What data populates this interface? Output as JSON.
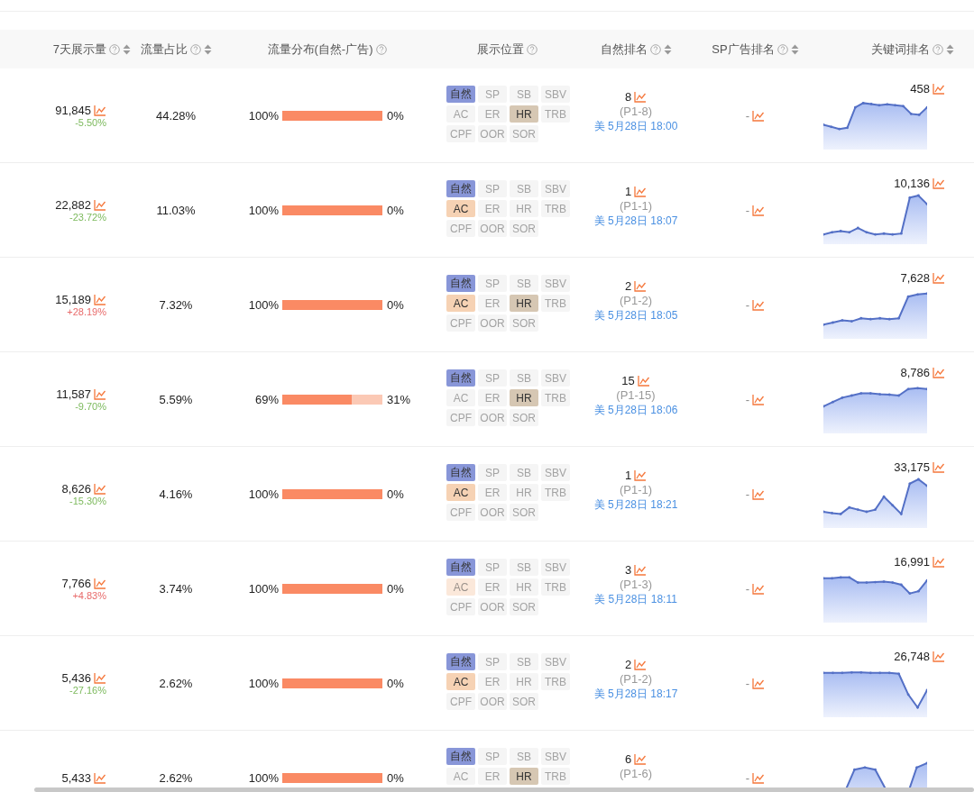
{
  "columns": [
    {
      "label": "7天展示量",
      "sortable": true
    },
    {
      "label": "流量占比",
      "sortable": true
    },
    {
      "label": "流量分布(自然-广告)",
      "sortable": false
    },
    {
      "label": "展示位置",
      "sortable": false
    },
    {
      "label": "自然排名",
      "sortable": true
    },
    {
      "label": "SP广告排名",
      "sortable": true
    },
    {
      "label": "关键词排名",
      "sortable": true
    }
  ],
  "rows": [
    {
      "impressions": "91,845",
      "change": "-5.50%",
      "rising": false,
      "share": "44.28%",
      "flow": {
        "natural": "100%",
        "ad": "0%",
        "level": 1
      },
      "tags": [
        {
          "label": "自然",
          "active": true,
          "color": "#8896d8"
        },
        {
          "label": "SP",
          "active": false
        },
        {
          "label": "SB",
          "active": false
        },
        {
          "label": "SBV",
          "active": false
        },
        {
          "label": "AC",
          "active": false
        },
        {
          "label": "ER",
          "active": false
        },
        {
          "label": "HR",
          "active": true,
          "color": "#d6c7b3"
        },
        {
          "label": "TRB",
          "active": false
        },
        {
          "label": "CPF",
          "active": false
        },
        {
          "label": "OOR",
          "active": false
        },
        {
          "label": "SOR",
          "active": false
        }
      ],
      "rank": "8",
      "rank_page": "(P1-8)",
      "rank_time": "美 5月28日 18:00",
      "sp_rank": "-",
      "keyword_rank": "458"
    },
    {
      "impressions": "22,882",
      "change": "-23.72%",
      "rising": false,
      "share": "11.03%",
      "flow": {
        "natural": "100%",
        "ad": "0%",
        "level": 1
      },
      "tags": [
        {
          "label": "自然",
          "active": true,
          "color": "#8896d8"
        },
        {
          "label": "SP",
          "active": false
        },
        {
          "label": "SB",
          "active": false
        },
        {
          "label": "SBV",
          "active": false
        },
        {
          "label": "AC",
          "active": true,
          "color": "#f6d2b4"
        },
        {
          "label": "ER",
          "active": false
        },
        {
          "label": "HR",
          "active": false
        },
        {
          "label": "TRB",
          "active": false
        },
        {
          "label": "CPF",
          "active": false
        },
        {
          "label": "OOR",
          "active": false
        },
        {
          "label": "SOR",
          "active": false
        }
      ],
      "rank": "1",
      "rank_page": "(P1-1)",
      "rank_time": "美 5月28日 18:07",
      "sp_rank": "-",
      "keyword_rank": "10,136"
    },
    {
      "impressions": "15,189",
      "change": "+28.19%",
      "rising": true,
      "share": "7.32%",
      "flow": {
        "natural": "100%",
        "ad": "0%",
        "level": 1
      },
      "tags": [
        {
          "label": "自然",
          "active": true,
          "color": "#8896d8"
        },
        {
          "label": "SP",
          "active": false
        },
        {
          "label": "SB",
          "active": false
        },
        {
          "label": "SBV",
          "active": false
        },
        {
          "label": "AC",
          "active": true,
          "color": "#f6d2b4"
        },
        {
          "label": "ER",
          "active": false
        },
        {
          "label": "HR",
          "active": true,
          "color": "#d6c7b3"
        },
        {
          "label": "TRB",
          "active": false
        },
        {
          "label": "CPF",
          "active": false
        },
        {
          "label": "OOR",
          "active": false
        },
        {
          "label": "SOR",
          "active": false
        }
      ],
      "rank": "2",
      "rank_page": "(P1-2)",
      "rank_time": "美 5月28日 18:05",
      "sp_rank": "-",
      "keyword_rank": "7,628"
    },
    {
      "impressions": "11,587",
      "change": "-9.70%",
      "rising": false,
      "share": "5.59%",
      "flow": {
        "natural": "69%",
        "ad": "31%",
        "level": 0.69
      },
      "tags": [
        {
          "label": "自然",
          "active": true,
          "color": "#8896d8"
        },
        {
          "label": "SP",
          "active": false
        },
        {
          "label": "SB",
          "active": false
        },
        {
          "label": "SBV",
          "active": false
        },
        {
          "label": "AC",
          "active": false
        },
        {
          "label": "ER",
          "active": false
        },
        {
          "label": "HR",
          "active": true,
          "color": "#d6c7b3"
        },
        {
          "label": "TRB",
          "active": false
        },
        {
          "label": "CPF",
          "active": false
        },
        {
          "label": "OOR",
          "active": false
        },
        {
          "label": "SOR",
          "active": false
        }
      ],
      "rank": "15",
      "rank_page": "(P1-15)",
      "rank_time": "美 5月28日 18:06",
      "sp_rank": "-",
      "keyword_rank": "8,786"
    },
    {
      "impressions": "8,626",
      "change": "-15.30%",
      "rising": false,
      "share": "4.16%",
      "flow": {
        "natural": "100%",
        "ad": "0%",
        "level": 1
      },
      "tags": [
        {
          "label": "自然",
          "active": true,
          "color": "#8896d8"
        },
        {
          "label": "SP",
          "active": false
        },
        {
          "label": "SB",
          "active": false
        },
        {
          "label": "SBV",
          "active": false
        },
        {
          "label": "AC",
          "active": true,
          "color": "#f6d2b4"
        },
        {
          "label": "ER",
          "active": false
        },
        {
          "label": "HR",
          "active": false
        },
        {
          "label": "TRB",
          "active": false
        },
        {
          "label": "CPF",
          "active": false
        },
        {
          "label": "OOR",
          "active": false
        },
        {
          "label": "SOR",
          "active": false
        }
      ],
      "rank": "1",
      "rank_page": "(P1-1)",
      "rank_time": "美 5月28日 18:21",
      "sp_rank": "-",
      "keyword_rank": "33,175"
    },
    {
      "impressions": "7,766",
      "change": "+4.83%",
      "rising": true,
      "share": "3.74%",
      "flow": {
        "natural": "100%",
        "ad": "0%",
        "level": 1
      },
      "tags": [
        {
          "label": "自然",
          "active": true,
          "color": "#8896d8"
        },
        {
          "label": "SP",
          "active": false
        },
        {
          "label": "SB",
          "active": false
        },
        {
          "label": "SBV",
          "active": false
        },
        {
          "label": "AC",
          "active": true,
          "color": "#fbe8da"
        },
        {
          "label": "ER",
          "active": false
        },
        {
          "label": "HR",
          "active": false
        },
        {
          "label": "TRB",
          "active": false
        },
        {
          "label": "CPF",
          "active": false
        },
        {
          "label": "OOR",
          "active": false
        },
        {
          "label": "SOR",
          "active": false
        }
      ],
      "rank": "3",
      "rank_page": "(P1-3)",
      "rank_time": "美 5月28日 18:11",
      "sp_rank": "-",
      "keyword_rank": "16,991"
    },
    {
      "impressions": "5,436",
      "change": "-27.16%",
      "rising": false,
      "share": "2.62%",
      "flow": {
        "natural": "100%",
        "ad": "0%",
        "level": 1
      },
      "tags": [
        {
          "label": "自然",
          "active": true,
          "color": "#8896d8"
        },
        {
          "label": "SP",
          "active": false
        },
        {
          "label": "SB",
          "active": false
        },
        {
          "label": "SBV",
          "active": false
        },
        {
          "label": "AC",
          "active": true,
          "color": "#f6d2b4"
        },
        {
          "label": "ER",
          "active": false
        },
        {
          "label": "HR",
          "active": false
        },
        {
          "label": "TRB",
          "active": false
        },
        {
          "label": "CPF",
          "active": false
        },
        {
          "label": "OOR",
          "active": false
        },
        {
          "label": "SOR",
          "active": false
        }
      ],
      "rank": "2",
      "rank_page": "(P1-2)",
      "rank_time": "美 5月28日 18:17",
      "sp_rank": "-",
      "keyword_rank": "26,748"
    },
    {
      "impressions": "5,433",
      "share": "2.62%",
      "flow": {
        "natural": "100%",
        "ad": "0%",
        "level": 1
      },
      "tags": [
        {
          "label": "自然",
          "active": true,
          "color": "#8896d8"
        },
        {
          "label": "SP",
          "active": false
        },
        {
          "label": "SB",
          "active": false
        },
        {
          "label": "SBV",
          "active": false
        },
        {
          "label": "AC",
          "active": false
        },
        {
          "label": "ER",
          "active": false
        },
        {
          "label": "HR",
          "active": true,
          "color": "#d6c7b3"
        },
        {
          "label": "TRB",
          "active": false
        }
      ],
      "rank": "6",
      "rank_page": "(P1-6)",
      "sp_rank": "-"
    }
  ]
}
